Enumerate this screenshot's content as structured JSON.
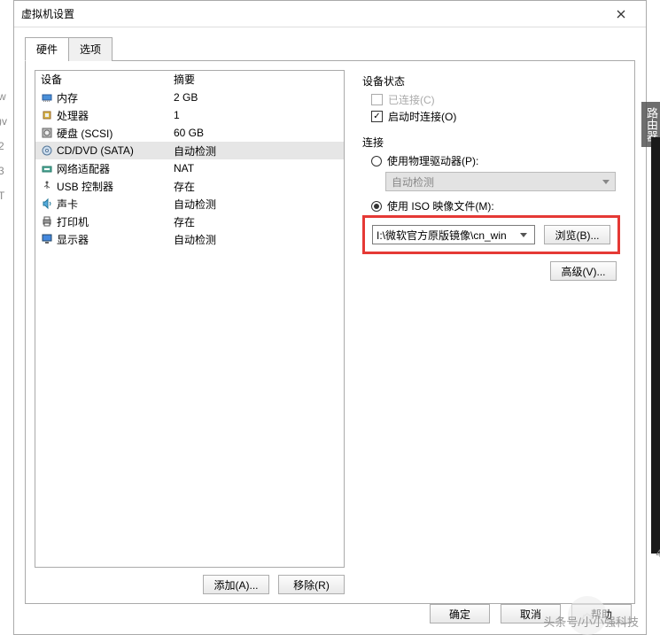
{
  "title": "虚拟机设置",
  "tabs": {
    "hardware": "硬件",
    "options": "选项"
  },
  "columns": {
    "device": "设备",
    "summary": "摘要"
  },
  "devices": [
    {
      "name": "内存",
      "summary": "2 GB",
      "icon": "memory"
    },
    {
      "name": "处理器",
      "summary": "1",
      "icon": "cpu"
    },
    {
      "name": "硬盘 (SCSI)",
      "summary": "60 GB",
      "icon": "disk"
    },
    {
      "name": "CD/DVD (SATA)",
      "summary": "自动检测",
      "icon": "cd",
      "selected": true
    },
    {
      "name": "网络适配器",
      "summary": "NAT",
      "icon": "net"
    },
    {
      "name": "USB 控制器",
      "summary": "存在",
      "icon": "usb"
    },
    {
      "name": "声卡",
      "summary": "自动检测",
      "icon": "sound"
    },
    {
      "name": "打印机",
      "summary": "存在",
      "icon": "printer"
    },
    {
      "name": "显示器",
      "summary": "自动检测",
      "icon": "display"
    }
  ],
  "buttons": {
    "add": "添加(A)...",
    "remove": "移除(R)",
    "browse": "浏览(B)...",
    "advanced": "高级(V)...",
    "ok": "确定",
    "cancel": "取消",
    "help": "帮助"
  },
  "status": {
    "group": "设备状态",
    "connected": "已连接(C)",
    "connectAtPowerOn": "启动时连接(O)"
  },
  "connection": {
    "group": "连接",
    "physical": "使用物理驱动器(P):",
    "physical_value": "自动检测",
    "iso": "使用 ISO 映像文件(M):",
    "iso_value": "I:\\微软官方原版镜像\\cn_win"
  },
  "watermark": "头条号/小小强科技",
  "side": "路由器"
}
